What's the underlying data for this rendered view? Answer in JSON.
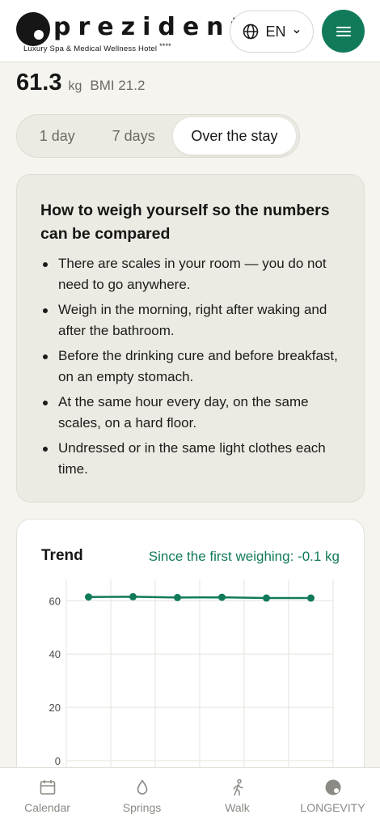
{
  "brand": {
    "name": "prezident",
    "tagline": "Luxury Spa & Medical Wellness Hotel",
    "stars": "****"
  },
  "header": {
    "language": "EN",
    "icons": {
      "language": "globe-icon",
      "language_chevron": "chevron-down-icon",
      "menu": "hamburger-menu-icon"
    }
  },
  "stats": {
    "weight": "61.3",
    "unit": "kg",
    "bmi": "BMI 21.2"
  },
  "period_tabs": [
    {
      "label": "1 day",
      "active": false
    },
    {
      "label": "7 days",
      "active": false
    },
    {
      "label": "Over the stay",
      "active": true
    }
  ],
  "info": {
    "title": "How to weigh yourself so the numbers can be compared",
    "tips": [
      "There are scales in your room — you do not need to go anywhere.",
      "Weigh in the morning, right after waking and after the bathroom.",
      "Before the drinking cure and before breakfast, on an empty stomach.",
      "At the same hour every day, on the same scales, on a hard floor.",
      "Undressed or in the same light clothes each time."
    ]
  },
  "trend": {
    "title": "Trend",
    "change": "Since the first weighing: -0.1 kg"
  },
  "chart_data": {
    "type": "line",
    "title": "",
    "xlabel": "",
    "ylabel": "",
    "yticks": [
      "0",
      "20",
      "40",
      "60"
    ],
    "ylim": [
      0,
      68
    ],
    "values": [
      61.4,
      61.5,
      61.2,
      61.3,
      61.0,
      61.0
    ],
    "color": "#117a5b",
    "grid": true
  },
  "tabs": [
    {
      "label": "Calendar",
      "icon": "calendar-icon"
    },
    {
      "label": "Springs",
      "icon": "water-drop-icon"
    },
    {
      "label": "Walk",
      "icon": "walking-person-icon"
    },
    {
      "label": "LONGEVITY",
      "icon": "longevity-logo-icon"
    }
  ],
  "colors": {
    "accent": "#117a5b",
    "background": "#f5f4ef",
    "card": "#ecebe3"
  }
}
